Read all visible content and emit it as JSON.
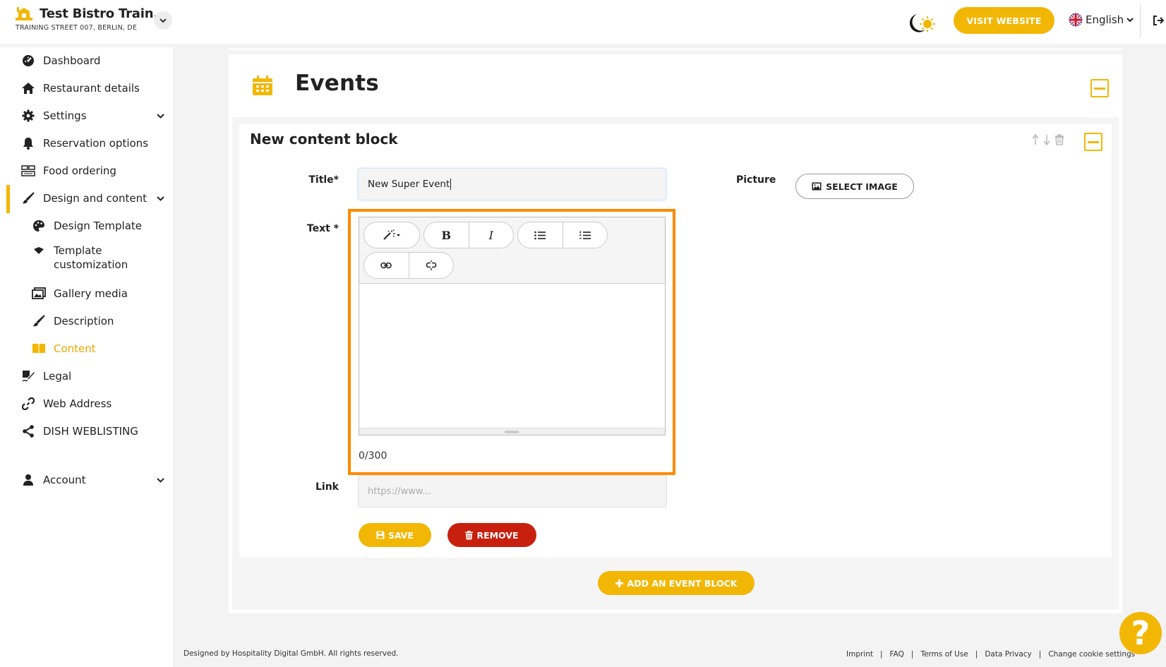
{
  "header": {
    "restaurant_name": "Test Bistro Train...",
    "address": "TRAINING STREET 007, BERLIN, DE",
    "visit_website": "VISIT WEBSITE",
    "language": "English"
  },
  "sidebar": {
    "items": [
      {
        "label": "Dashboard"
      },
      {
        "label": "Restaurant details"
      },
      {
        "label": "Settings"
      },
      {
        "label": "Reservation options"
      },
      {
        "label": "Food ordering"
      },
      {
        "label": "Design and content"
      },
      {
        "label": "Design Template"
      },
      {
        "label": "Template customization"
      },
      {
        "label": "Gallery media"
      },
      {
        "label": "Description"
      },
      {
        "label": "Content"
      },
      {
        "label": "Legal"
      },
      {
        "label": "Web Address"
      },
      {
        "label": "DISH WEBLISTING"
      },
      {
        "label": "Account"
      }
    ]
  },
  "main": {
    "section_title": "Events",
    "block_title": "New content block",
    "form": {
      "title_label": "Title*",
      "title_value": "New Super Event",
      "text_label": "Text *",
      "picture_label": "Picture",
      "select_image": "SELECT IMAGE",
      "counter": "0/300",
      "link_label": "Link",
      "link_placeholder": "https://www...",
      "save": "SAVE",
      "remove": "REMOVE"
    },
    "add_block": "ADD AN EVENT BLOCK"
  },
  "footer": {
    "copyright": "Designed by Hospitality Digital GmbH. All rights reserved.",
    "links": [
      "Imprint",
      "FAQ",
      "Terms of Use",
      "Data Privacy",
      "Change cookie settings"
    ]
  },
  "colors": {
    "accent": "#f2b705",
    "danger": "#c8200e",
    "highlight": "#ff8a00"
  }
}
